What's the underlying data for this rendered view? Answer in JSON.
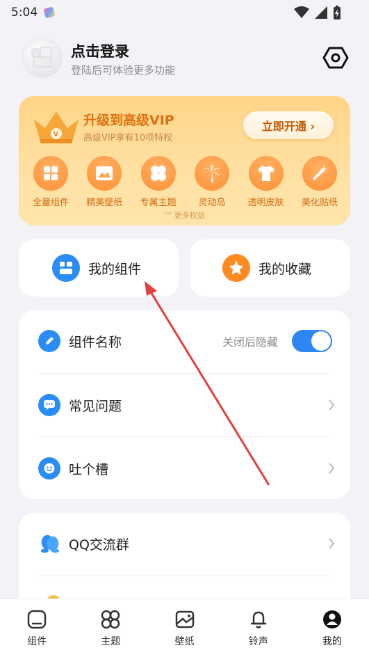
{
  "status_bar": {
    "time": "5:04"
  },
  "profile": {
    "title": "点击登录",
    "subtitle": "登陆后可体验更多功能"
  },
  "vip": {
    "title": "升级到高级VIP",
    "subtitle": "高级VIP享有10项特权",
    "button": "立即开通 ›",
    "features": [
      "全量组件",
      "精美壁纸",
      "专属主题",
      "灵动岛",
      "透明皮肤",
      "美化贴纸"
    ],
    "more": "更多权益"
  },
  "quick": {
    "widgets": "我的组件",
    "favorites": "我的收藏"
  },
  "settings_list": {
    "widget_name": "组件名称",
    "hide_after_close": "关闭后隐藏",
    "faq": "常见问题",
    "feedback": "吐个槽"
  },
  "community": {
    "qq_group": "QQ交流群"
  },
  "bottom_nav": [
    "组件",
    "主题",
    "壁纸",
    "铃声",
    "我的"
  ],
  "colors": {
    "accent_blue": "#2d86f2",
    "vip_orange": "#e0700c",
    "favorite_orange": "#ff8a1f",
    "arrow_red": "#e2403c"
  }
}
